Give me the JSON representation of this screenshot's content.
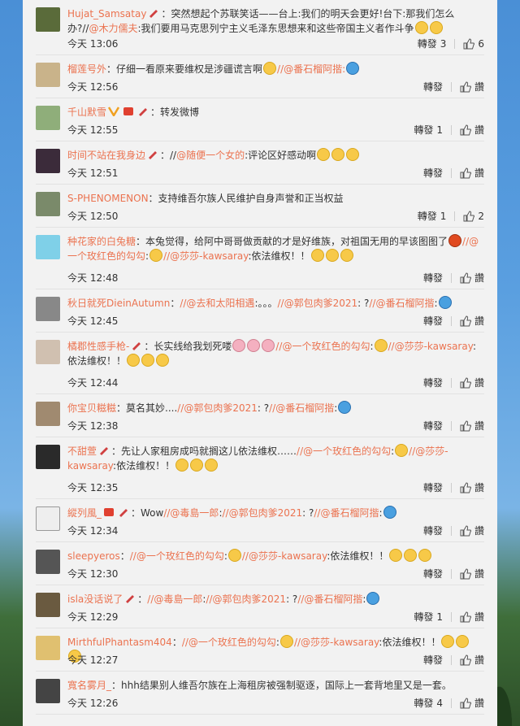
{
  "comments": [
    {
      "user": "Hujat_Samsatay",
      "text": "：突然想起个苏联笑话——台上:我们的明天会更好!台下:那我们怎么办?//",
      "at": "@木力儒夫",
      "text2": ":我们要用马克思列宁主义毛泽东思想来和这些帝国主义者作斗争",
      "time": "今天 13:06",
      "repost": "轉發",
      "repost_count": "3",
      "like_count": "6",
      "avatar": "#5a6b3a"
    },
    {
      "user": "榴莲号外",
      "text": "：仔细一看原来要维权是涉疆谎言啊",
      "at": "//@番石榴阿揩:",
      "text2": "",
      "time": "今天 12:56",
      "repost": "轉發",
      "like": "讚",
      "avatar": "#c9b38a"
    },
    {
      "user": "千山默雪",
      "text": "：转发微博",
      "time": "今天 12:55",
      "repost": "轉發",
      "repost_count": "1",
      "like": "讚",
      "avatar": "#8fae7a"
    },
    {
      "user": "时间不站在我身边",
      "text": "：//",
      "at": "@随便一个女的",
      "text2": ":评论区好感动啊",
      "time": "今天 12:51",
      "repost": "轉發",
      "like": "讚",
      "avatar": "#3b2b3a"
    },
    {
      "user": "S-PHENOMENON",
      "text": "：支持维吾尔族人民维护自身声誉和正当权益",
      "time": "今天 12:50",
      "repost": "轉發",
      "repost_count": "1",
      "like_count": "2",
      "avatar": "#7a8a6a"
    },
    {
      "user": "种花家的白兔糖",
      "text": "：本兔觉得，给阿中哥哥做贡献的才是好维族，对祖国无用的早该图图了",
      "at": "//@一个玫红色的勾勾",
      "text2": ":",
      "at2": "//@莎莎-kawsaray",
      "text3": ":依法维权！！",
      "time": "今天 12:48",
      "repost": "轉發",
      "like": "讚",
      "avatar": "#7fd0e8"
    },
    {
      "user": "秋日就死DieinAutumn",
      "text": "：",
      "at": "//@去和太阳相遇",
      "text2": ":。。。",
      "at2": "//@郭包肉爹2021",
      "text3": ": ?",
      "at3": "//@番石榴阿揩",
      "text4": ":",
      "time": "今天 12:45",
      "repost": "轉發",
      "like": "讚",
      "avatar": "#888888"
    },
    {
      "user": "橘郡性感手枪-",
      "text": "：长实线给我划死喽",
      "at": "//@一个玫红色的勾勾",
      "text2": ":",
      "at2": "//@莎莎-kawsaray",
      "text3": ":依法维权！！",
      "time": "今天 12:44",
      "repost": "轉發",
      "like": "讚",
      "avatar": "#d0c0b0"
    },
    {
      "user": "你宝贝糍糍",
      "text": "：莫名其妙....",
      "at": "//@郭包肉爹2021",
      "text2": ": ?",
      "at2": "//@番石榴阿揩",
      "text3": ":",
      "time": "今天 12:38",
      "repost": "轉發",
      "like": "讚",
      "avatar": "#a08a70"
    },
    {
      "user": "不甜萱",
      "text": "：先让人家租房成吗就搁这儿依法维权……",
      "at": "//@一个玫红色的勾勾",
      "text2": ":",
      "at2": "//@莎莎-kawsaray",
      "text3": ":依法维权！！",
      "time": "今天 12:35",
      "repost": "轉發",
      "like": "讚",
      "avatar": "#2a2a2a"
    },
    {
      "user": "縱列風_",
      "text": "：Wow",
      "at": "//@毒島一郎",
      "text2": ":",
      "at2": "//@郭包肉爹2021",
      "text3": ": ?",
      "at3": "//@番石榴阿揩",
      "text4": ":",
      "time": "今天 12:34",
      "repost": "轉發",
      "like": "讚",
      "avatar": "#eeeeee"
    },
    {
      "user": "sleepyeros",
      "text": "：",
      "at": "//@一个玫红色的勾勾",
      "text2": ":",
      "at2": "//@莎莎-kawsaray",
      "text3": ":依法维权！！",
      "time": "今天 12:30",
      "repost": "轉發",
      "like": "讚",
      "avatar": "#555555"
    },
    {
      "user": "isla没话说了",
      "text": "：",
      "at": "//@毒島一郎",
      "text2": ":",
      "at2": "//@郭包肉爹2021",
      "text3": ": ?",
      "at3": "//@番石榴阿揩",
      "text4": ":",
      "time": "今天 12:29",
      "repost": "轉發",
      "repost_count": "1",
      "like": "讚",
      "avatar": "#6a5a40"
    },
    {
      "user": "MirthfulPhantasm404",
      "text": "：",
      "at": "//@一个玫红色的勾勾",
      "text2": ":",
      "at2": "//@莎莎-kawsaray",
      "text3": ":依法维权！！",
      "time": "今天 12:27",
      "repost": "轉發",
      "like": "讚",
      "avatar": "#e0c070"
    },
    {
      "user": "寬名雾月_",
      "text": "：hhh结果别人维吾尔族在上海租房被强制驱逐，国际上一套背地里又是一套。",
      "time": "今天 12:26",
      "repost": "轉發",
      "repost_count": "4",
      "like": "讚",
      "avatar": "#444444"
    }
  ]
}
